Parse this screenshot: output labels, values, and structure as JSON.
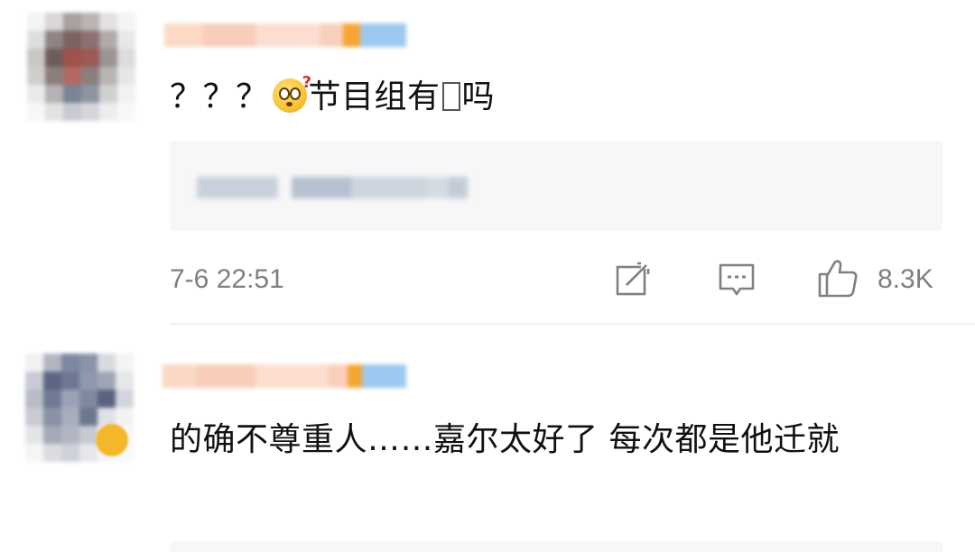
{
  "comments": [
    {
      "text_prefix": "？？？",
      "emoji": "thinking-question-emoji",
      "text_suffix_a": "节目组有",
      "text_suffix_b": "吗",
      "timestamp": "7-6 22:51",
      "like_count": "8.3K"
    },
    {
      "text": "的确不尊重人……嘉尔太好了 每次都是他迁就"
    }
  ],
  "icons": {
    "share": "share-edit-icon",
    "comment": "comment-bubble-icon",
    "like": "thumbs-up-icon"
  },
  "colors": {
    "meta_text": "#7f7f7f",
    "quote_bg": "#f7f7f7",
    "username_peach": "#f8cdb9",
    "username_blue": "#9cc9ef",
    "username_orange": "#f6a531"
  }
}
